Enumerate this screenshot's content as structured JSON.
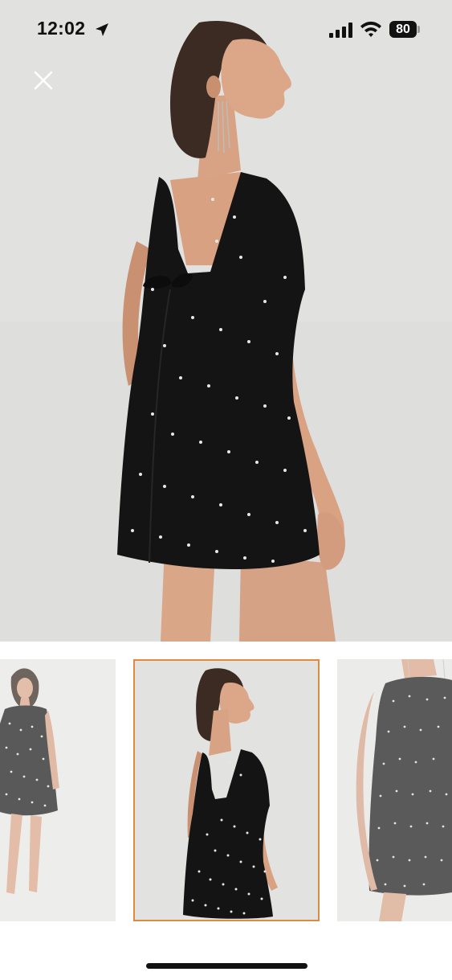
{
  "status_bar": {
    "time": "12:02",
    "battery_level": "80",
    "icons": [
      "location-arrow-icon",
      "cellular-signal-icon",
      "wifi-icon",
      "battery-icon"
    ]
  },
  "viewer": {
    "close_icon": "close-icon",
    "selected_index": 1,
    "thumbnail_count": 3
  },
  "colors": {
    "selected_border": "#e0893f",
    "dress": "#141414",
    "background": "#ffffff"
  }
}
